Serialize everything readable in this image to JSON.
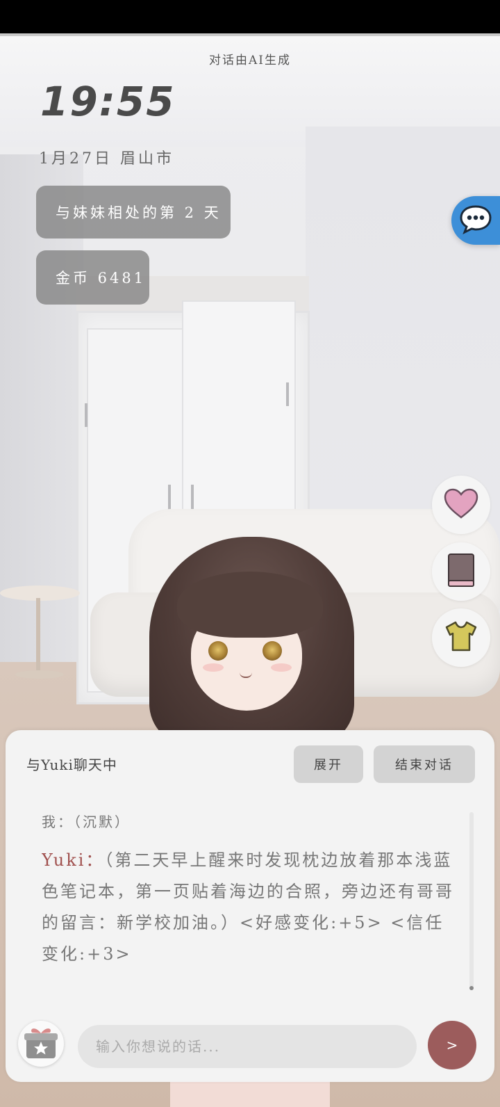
{
  "notice": "对话由AI生成",
  "clock": "19:55",
  "date_location": "1月27日  眉山市",
  "days_badge": "与妹妹相处的第 2 天",
  "coins_badge": "金币 6481",
  "chat": {
    "title": "与Yuki聊天中",
    "expand_label": "展开",
    "end_label": "结束对话",
    "messages": [
      {
        "speaker": "我：",
        "text": "（沉默）"
      },
      {
        "speaker": "Yuki：",
        "text": "（第二天早上醒来时发现枕边放着那本浅蓝色笔记本，第一页贴着海边的合照，旁边还有哥哥的留言：新学校加油。）<好感变化:+5> <信任变化:+3>"
      }
    ],
    "input_placeholder": "输入你想说的话...",
    "send_label": ">"
  },
  "icons": {
    "chat_fab": "speech-bubble-icon",
    "heart": "heart-icon",
    "book": "book-icon",
    "shirt": "shirt-icon",
    "gift": "gift-icon"
  },
  "colors": {
    "chat_fab": "#3d8fd8",
    "heart": "#e3a3c0",
    "book": "#7d6a6d",
    "shirt": "#d4c75c",
    "send_button": "#9c5c5c",
    "yuki_name": "#a0504e"
  }
}
